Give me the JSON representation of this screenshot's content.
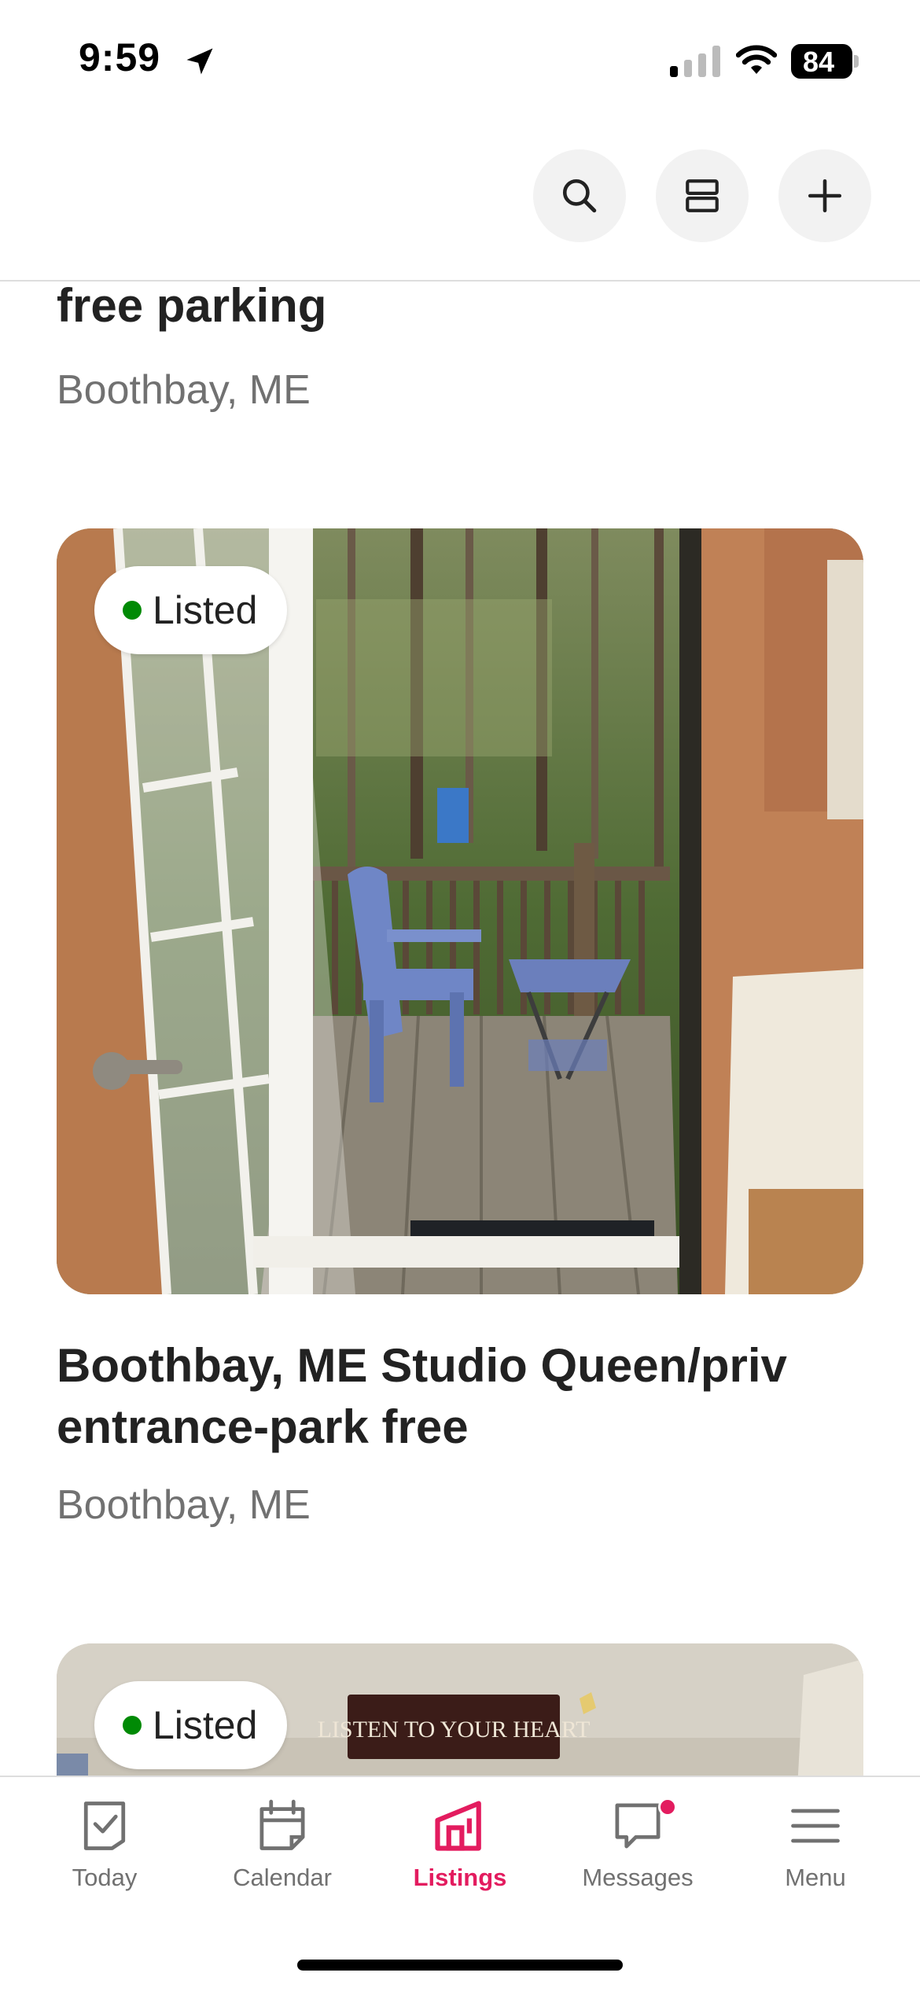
{
  "status_bar": {
    "time": "9:59",
    "battery": "84"
  },
  "header": {
    "search_icon": "search-icon",
    "view_toggle_icon": "view-toggle-icon",
    "add_icon": "plus-icon"
  },
  "listings": [
    {
      "title": "free parking",
      "location": "Boothbay, ME"
    },
    {
      "status": "Listed",
      "title": "Boothbay, ME Studio Queen/priv entrance-park free",
      "location": "Boothbay, ME",
      "photo_sign_text": "LISTEN TO YOUR HEART"
    },
    {
      "status": "Listed",
      "photo_sign_text": "LISTEN TO YOUR HEART"
    }
  ],
  "tab_bar": {
    "tabs": [
      {
        "label": "Today",
        "icon": "check-calendar-icon"
      },
      {
        "label": "Calendar",
        "icon": "calendar-icon"
      },
      {
        "label": "Listings",
        "icon": "house-icon",
        "active": true
      },
      {
        "label": "Messages",
        "icon": "chat-icon",
        "has_notification": true
      },
      {
        "label": "Menu",
        "icon": "hamburger-icon"
      }
    ]
  },
  "colors": {
    "accent": "#e31c5f",
    "listed_dot": "#008a05",
    "secondary_text": "#717171"
  }
}
